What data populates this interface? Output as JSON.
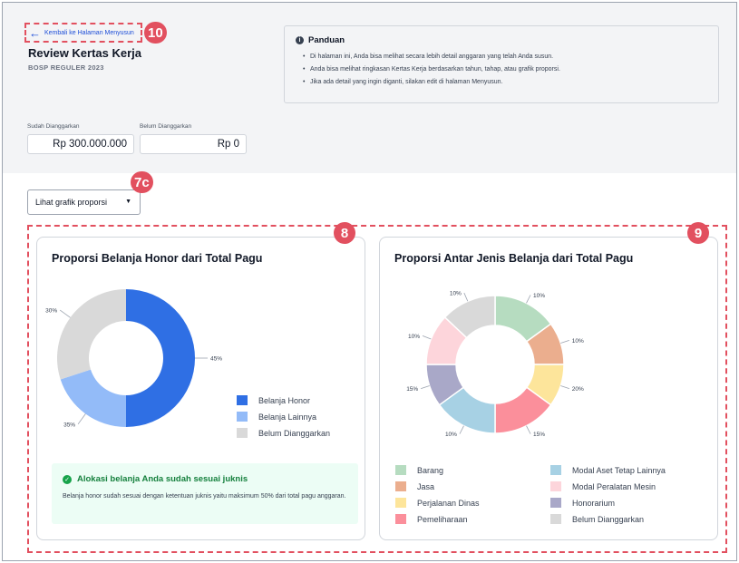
{
  "header": {
    "back_link": "Kembali ke Halaman Menyusun",
    "title": "Review Kertas Kerja",
    "subtitle": "BOSP REGULER 2023"
  },
  "guide": {
    "title": "Panduan",
    "items": [
      "Di halaman ini, Anda bisa melihat secara lebih detail anggaran yang telah Anda susun.",
      "Anda bisa melihat ringkasan Kertas Kerja berdasarkan tahun, tahap, atau grafik proporsi.",
      "Jika ada detail yang ingin diganti, silakan edit di halaman Menyusun."
    ]
  },
  "stats": {
    "budgeted_label": "Sudah Dianggarkan",
    "budgeted_value": "Rp 300.000.000",
    "unbudgeted_label": "Belum Dianggarkan",
    "unbudgeted_value": "Rp 0"
  },
  "view_select": {
    "value": "Lihat grafik proporsi"
  },
  "badges": {
    "back": "10",
    "select": "7c",
    "card1": "8",
    "card2": "9"
  },
  "honor_card": {
    "title": "Proporsi Belanja Honor dari Total Pagu",
    "success_title": "Alokasi belanja Anda sudah sesuai juknis",
    "success_text": "Belanja honor sudah sesuai dengan ketentuan juknis yaitu maksimum 50% dari total pagu anggaran."
  },
  "types_card": {
    "title": "Proporsi Antar Jenis Belanja dari Total Pagu"
  },
  "chart_data": [
    {
      "type": "pie",
      "title": "Proporsi Belanja Honor dari Total Pagu",
      "categories": [
        "Belanja Honor",
        "Belanja Lainnya",
        "Belum Dianggarkan"
      ],
      "values": [
        50,
        20,
        30
      ],
      "data_labels": [
        "45%",
        "35%",
        "30%"
      ],
      "colors": [
        "#2f6fe4",
        "#93bbf8",
        "#d9d9d9"
      ],
      "legend": "right"
    },
    {
      "type": "pie",
      "title": "Proporsi Antar Jenis Belanja dari Total Pagu",
      "categories": [
        "Barang",
        "Jasa",
        "Perjalanan Dinas",
        "Pemeliharaan",
        "Modal Aset Tetap Lainnya",
        "Modal Peralatan Mesin",
        "Honorarium",
        "Belum Dianggarkan"
      ],
      "slices": [
        {
          "name": "Barang",
          "value": 15,
          "label": "10%",
          "color": "#b6dcc0"
        },
        {
          "name": "Jasa",
          "value": 10,
          "label": "10%",
          "color": "#ebae8e"
        },
        {
          "name": "Perjalanan Dinas",
          "value": 10,
          "label": "20%",
          "color": "#fde59b"
        },
        {
          "name": "Pemeliharaan",
          "value": 15,
          "label": "15%",
          "color": "#fb8f9b"
        },
        {
          "name": "Modal Aset Tetap Lainnya",
          "value": 15,
          "label": "10%",
          "color": "#a7d1e4"
        },
        {
          "name": "Honorarium",
          "value": 10,
          "label": "15%",
          "color": "#a9a8c8"
        },
        {
          "name": "Modal Peralatan Mesin",
          "value": 12,
          "label": "10%",
          "color": "#fdd5db"
        },
        {
          "name": "Belum Dianggarkan",
          "value": 13,
          "label": "10%",
          "color": "#d9d9d9"
        }
      ],
      "legend_colors": [
        "#b6dcc0",
        "#ebae8e",
        "#fde59b",
        "#fb8f9b",
        "#a7d1e4",
        "#fdd5db",
        "#a9a8c8",
        "#d9d9d9"
      ],
      "legend": "bottom"
    }
  ]
}
